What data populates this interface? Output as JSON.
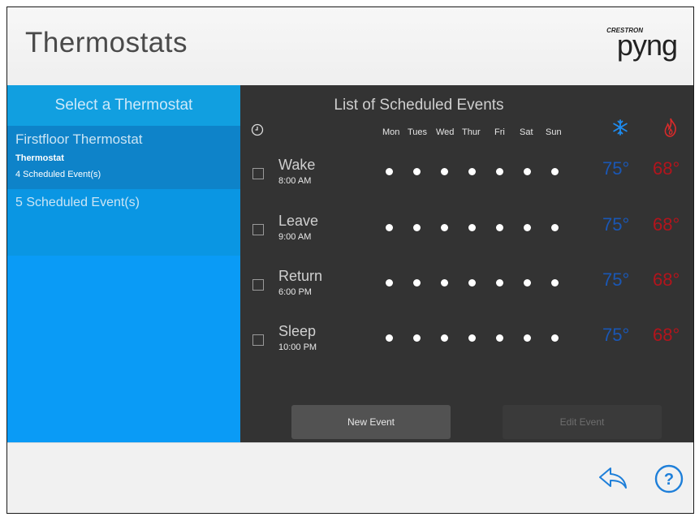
{
  "header": {
    "title": "Thermostats",
    "logo_small": "CRESTRON",
    "logo_main": "pyng"
  },
  "sidebar": {
    "heading": "Select a Thermostat",
    "thermostat": {
      "name": "Firstfloor Thermostat",
      "type": "Thermostat",
      "events_count": "4 Scheduled Event(s)"
    },
    "schedule_item": "5 Scheduled Event(s)"
  },
  "panel": {
    "title": "List of Scheduled Events",
    "days": [
      "Mon",
      "Tues",
      "Wed",
      "Thur",
      "Fri",
      "Sat",
      "Sun"
    ],
    "events": [
      {
        "name": "Wake",
        "time": "8:00 AM",
        "cool": "75°",
        "heat": "68°"
      },
      {
        "name": "Leave",
        "time": "9:00 AM",
        "cool": "75°",
        "heat": "68°"
      },
      {
        "name": "Return",
        "time": "6:00 PM",
        "cool": "75°",
        "heat": "68°"
      },
      {
        "name": "Sleep",
        "time": "10:00 PM",
        "cool": "75°",
        "heat": "68°"
      }
    ],
    "new_event": "New Event",
    "edit_event": "Edit Event"
  },
  "colors": {
    "sidebar": "#0a9bf6",
    "panel": "#333333",
    "cool": "#1a57b5",
    "heat": "#b3141c"
  },
  "icons": [
    "clock-icon",
    "snowflake-icon",
    "flame-icon",
    "back-arrow-icon",
    "help-icon"
  ]
}
